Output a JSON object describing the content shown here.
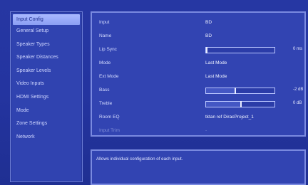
{
  "menu": {
    "items": [
      {
        "label": "Input Config",
        "selected": true
      },
      {
        "label": "General Setup",
        "selected": false
      },
      {
        "label": "Speaker Types",
        "selected": false
      },
      {
        "label": "Speaker Distances",
        "selected": false
      },
      {
        "label": "Speaker Levels",
        "selected": false
      },
      {
        "label": "Video Inputs",
        "selected": false
      },
      {
        "label": "HDMI Settings",
        "selected": false
      },
      {
        "label": "Mode",
        "selected": false
      },
      {
        "label": "Zone Settings",
        "selected": false
      },
      {
        "label": "Network",
        "selected": false
      }
    ]
  },
  "settings": {
    "input": {
      "label": "Input",
      "value": "BD"
    },
    "name": {
      "label": "Name",
      "value": "BD"
    },
    "lip_sync": {
      "label": "Lip Sync",
      "level": 0.0,
      "unit_value": "0 ms"
    },
    "mode": {
      "label": "Mode",
      "value": "Last Mode"
    },
    "ext_mode": {
      "label": "Ext Mode",
      "value": "Last Mode"
    },
    "bass": {
      "label": "Bass",
      "level": 0.42,
      "unit_value": "-2 dB"
    },
    "treble": {
      "label": "Treble",
      "level": 0.5,
      "unit_value": "0 dB"
    },
    "room_eq": {
      "label": "Room EQ",
      "value": "tktan ref DiracProject_1"
    },
    "input_trim": {
      "label": "Input Trim",
      "value": "-"
    }
  },
  "help": {
    "text": "Allows individual configuration of each input."
  },
  "colors": {
    "background": "#2434a0",
    "panel": "#3244b2",
    "border": "#7a8ae0",
    "selected": "#a9b9ff"
  }
}
